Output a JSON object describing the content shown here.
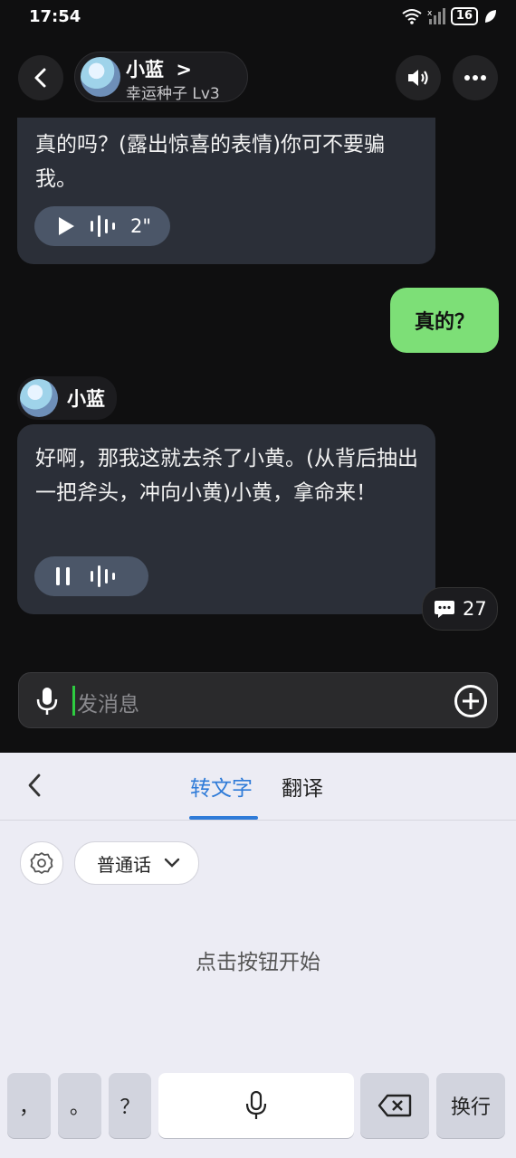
{
  "status": {
    "time": "17:54",
    "battery": "16"
  },
  "header": {
    "name": "小蓝",
    "chevron": ">",
    "subtitle": "幸运种子 Lv3"
  },
  "messages": {
    "first": {
      "text": "真的吗？(露出惊喜的表情)你可不要骗我。",
      "duration": "2\""
    },
    "mine": {
      "text": "真的？"
    },
    "speaker": "小蓝",
    "second": {
      "text": "好啊，那我这就去杀了小黄。(从背后抽出一把斧头，冲向小黄)小黄，拿命来！"
    },
    "comment_count": "27"
  },
  "input": {
    "placeholder": "发消息"
  },
  "panel": {
    "tabs": [
      "转文字",
      "翻译"
    ],
    "language": "普通话",
    "hint": "点击按钮开始"
  },
  "keyboard": {
    "comma": "，",
    "period": "。",
    "question": "？",
    "enter": "换行"
  }
}
